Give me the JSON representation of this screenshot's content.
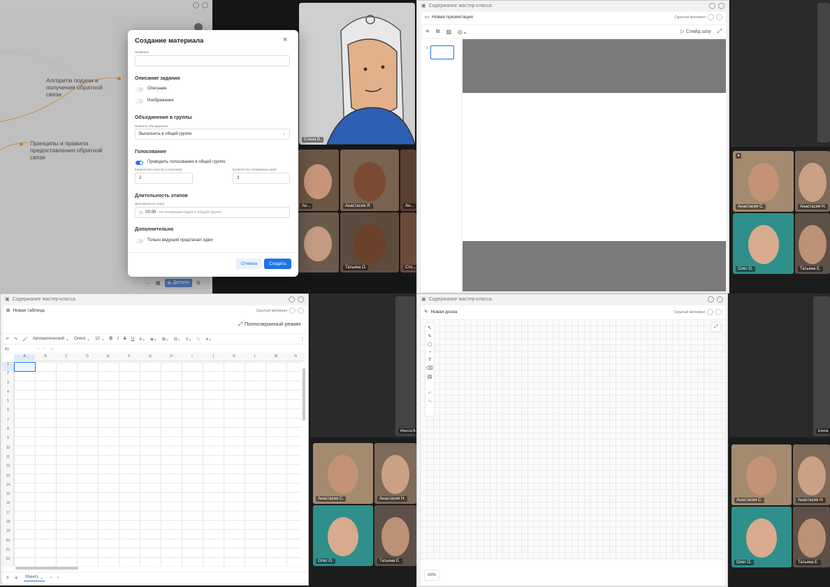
{
  "quad1": {
    "mindmap": {
      "node1": "Алгоритм подачи и получения обратной связи",
      "node2": "Принципы и правила предоставления обратной связи"
    },
    "toolbar_details": "Детали",
    "camera_main_label": "Елена В.",
    "tiles": [
      "Ан...",
      "Анастасия Я.",
      "Ан...",
      "Татьяна О.",
      "Сто..."
    ]
  },
  "modal": {
    "title": "Создание материала",
    "name_label": "Название",
    "name_value": "",
    "task_section": "Описание задания",
    "toggle_description": "Описание",
    "toggle_image": "Изображение",
    "groups_section": "Объединение в группы",
    "groups_rule_label": "Правило объединения",
    "groups_rule_value": "Выполнять в общей группе",
    "voting_section": "Голосование",
    "voting_toggle": "Проводить голосование в общей группе",
    "votes_per_participant_label": "Количество голосов у участника",
    "votes_per_participant_value": "2",
    "selected_ideas_label": "Количество отбираемых идей",
    "selected_ideas_value": "3",
    "duration_section": "Длительность этапов",
    "duration_label": "Длительность этапа",
    "duration_time": "00:00",
    "duration_placeholder": "на генерацию идей в общей группе",
    "extra_section": "Дополнительно",
    "extra_toggle": "Только ведущий предлагает идеи",
    "cancel": "Отмена",
    "create": "Создать"
  },
  "quad2": {
    "window_title": "Содержание мастер-класса",
    "doc_title": "Новая презентация",
    "hidden_material": "Скрытый материал",
    "slideshow": "Слайд шоу",
    "slide_number": "1",
    "tiles": [
      "Анастасия С.",
      "Анастасия Н.",
      "Олег О.",
      "Татьяна Е."
    ]
  },
  "quad3": {
    "window_title": "Содержание мастер-класса",
    "doc_title": "Новая таблица",
    "hidden_material": "Скрытый материал",
    "fullscreen": "Полноэкранный режим",
    "format": "Автоматический",
    "font": "Oneol",
    "font_size": "10",
    "cell_ref": "A1",
    "columns": [
      "A",
      "B",
      "C",
      "D",
      "E",
      "F",
      "G",
      "H",
      "I",
      "J",
      "K",
      "L",
      "M",
      "N"
    ],
    "rows": [
      "1",
      "2",
      "3",
      "4",
      "5",
      "6",
      "7",
      "8",
      "9",
      "10",
      "11",
      "12",
      "13",
      "14",
      "15",
      "16",
      "17",
      "18",
      "19",
      "20",
      "21",
      "22"
    ],
    "sheet_tab": "Sheet1",
    "right_top_label": "Инесса В.",
    "tiles": [
      "Анастасия С.",
      "Анастасия Н.",
      "Олег О.",
      "Татьяна Е."
    ]
  },
  "quad4": {
    "window_title": "Содержание мастер-класса",
    "doc_title": "Новая доска",
    "hidden_material": "Скрытый материал",
    "zoom": "100%",
    "right_top_label": "Елена",
    "tiles": [
      "Анастасия С.",
      "Анастасия Н.",
      "Олег О.",
      "Татьяна Е."
    ]
  }
}
